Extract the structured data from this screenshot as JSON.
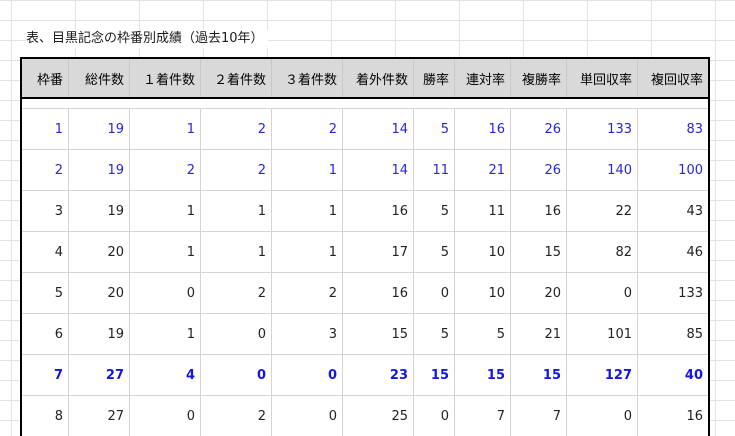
{
  "caption": "表、目黒記念の枠番別成績（過去10年）",
  "table": {
    "headers": [
      "枠番",
      "総件数",
      "１着件数",
      "２着件数",
      "３着件数",
      "着外件数",
      "勝率",
      "連対率",
      "複勝率",
      "単回収率",
      "複回収率"
    ],
    "rows": [
      {
        "style": "blue",
        "cells": [
          "1",
          "19",
          "1",
          "2",
          "2",
          "14",
          "5",
          "16",
          "26",
          "133",
          "83"
        ]
      },
      {
        "style": "blue",
        "cells": [
          "2",
          "19",
          "2",
          "2",
          "1",
          "14",
          "11",
          "21",
          "26",
          "140",
          "100"
        ]
      },
      {
        "style": "normal",
        "cells": [
          "3",
          "19",
          "1",
          "1",
          "1",
          "16",
          "5",
          "11",
          "16",
          "22",
          "43"
        ]
      },
      {
        "style": "normal",
        "cells": [
          "4",
          "20",
          "1",
          "1",
          "1",
          "17",
          "5",
          "10",
          "15",
          "82",
          "46"
        ]
      },
      {
        "style": "normal",
        "cells": [
          "5",
          "20",
          "0",
          "2",
          "2",
          "16",
          "0",
          "10",
          "20",
          "0",
          "133"
        ]
      },
      {
        "style": "normal",
        "cells": [
          "6",
          "19",
          "1",
          "0",
          "3",
          "15",
          "5",
          "5",
          "21",
          "101",
          "85"
        ]
      },
      {
        "style": "blue-bold",
        "cells": [
          "7",
          "27",
          "4",
          "0",
          "0",
          "23",
          "15",
          "15",
          "15",
          "127",
          "40"
        ]
      },
      {
        "style": "normal",
        "cells": [
          "8",
          "27",
          "0",
          "2",
          "0",
          "25",
          "0",
          "7",
          "7",
          "0",
          "16"
        ]
      }
    ]
  },
  "colors": {
    "highlight_blue": "#2727d9",
    "header_bg": "#d9d9d9",
    "border": "#000000"
  }
}
